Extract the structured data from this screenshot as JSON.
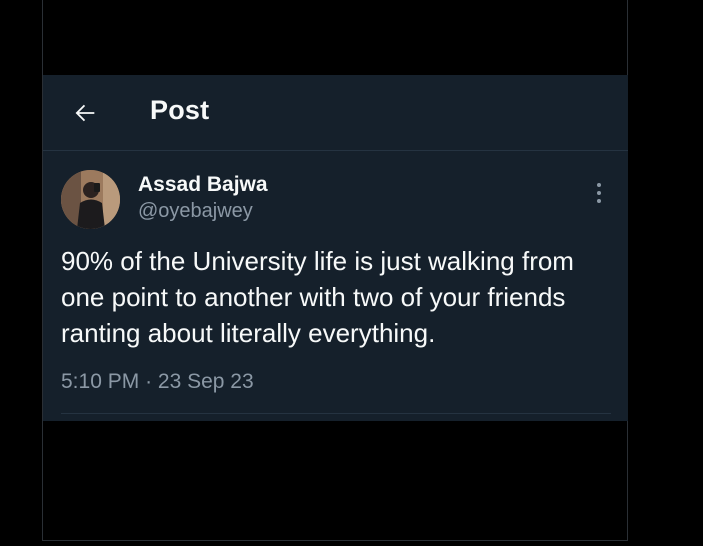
{
  "header": {
    "back_icon": "arrow-left-icon",
    "title": "Post"
  },
  "post": {
    "author_name": "Assad Bajwa",
    "author_handle": "@oyebajwey",
    "more_icon": "more-vertical-icon",
    "text": "90% of the University life is just walking from one point to another with two of your friends ranting about literally everything.",
    "time": "5:10 PM",
    "separator": "·",
    "date": "23 Sep 23"
  },
  "colors": {
    "background": "#000000",
    "card": "#15202b",
    "text_primary": "#f7f9f9",
    "text_secondary": "#8b98a5",
    "border": "#253341"
  }
}
